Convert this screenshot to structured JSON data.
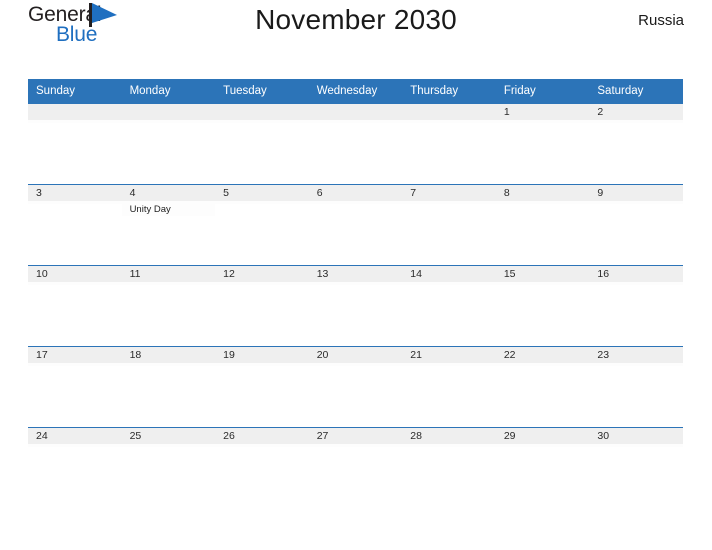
{
  "brand": {
    "word_general": "General",
    "word_blue": "Blue",
    "accent_color": "#1f6fc0",
    "flag_icon": "triangle-flag-icon"
  },
  "header": {
    "title": "November 2030",
    "country": "Russia"
  },
  "theme": {
    "header_blue": "#2c74b8",
    "date_band_gray": "#efefef",
    "separator_blue": "#2c74b8",
    "text_dark": "#1a1a1a"
  },
  "calendar": {
    "weekday_headers": [
      "Sunday",
      "Monday",
      "Tuesday",
      "Wednesday",
      "Thursday",
      "Friday",
      "Saturday"
    ],
    "weeks": [
      [
        {
          "day": ""
        },
        {
          "day": ""
        },
        {
          "day": ""
        },
        {
          "day": ""
        },
        {
          "day": ""
        },
        {
          "day": "1"
        },
        {
          "day": "2"
        }
      ],
      [
        {
          "day": "3"
        },
        {
          "day": "4",
          "event": "Unity Day"
        },
        {
          "day": "5"
        },
        {
          "day": "6"
        },
        {
          "day": "7"
        },
        {
          "day": "8"
        },
        {
          "day": "9"
        }
      ],
      [
        {
          "day": "10"
        },
        {
          "day": "11"
        },
        {
          "day": "12"
        },
        {
          "day": "13"
        },
        {
          "day": "14"
        },
        {
          "day": "15"
        },
        {
          "day": "16"
        }
      ],
      [
        {
          "day": "17"
        },
        {
          "day": "18"
        },
        {
          "day": "19"
        },
        {
          "day": "20"
        },
        {
          "day": "21"
        },
        {
          "day": "22"
        },
        {
          "day": "23"
        }
      ],
      [
        {
          "day": "24"
        },
        {
          "day": "25"
        },
        {
          "day": "26"
        },
        {
          "day": "27"
        },
        {
          "day": "28"
        },
        {
          "day": "29"
        },
        {
          "day": "30"
        }
      ]
    ]
  }
}
